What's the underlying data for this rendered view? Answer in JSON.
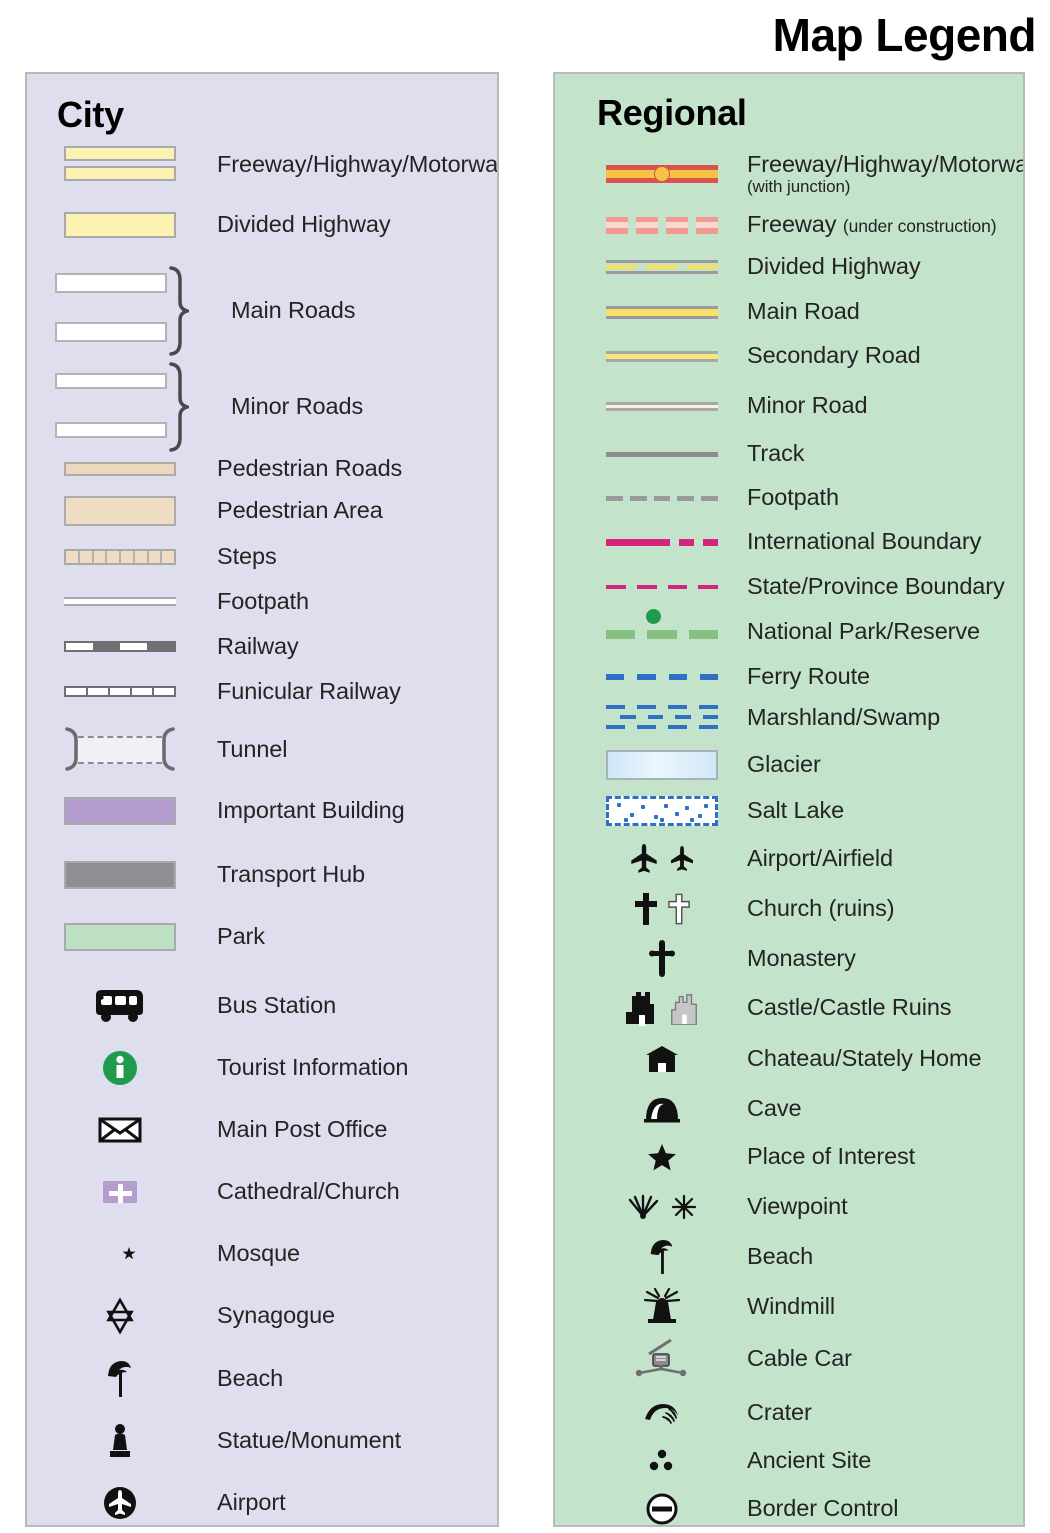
{
  "title": "Map Legend",
  "panels": {
    "city": {
      "heading": "City",
      "bg_color": "#dedeee",
      "items": [
        {
          "label": "Freeway/Highway/Motorway",
          "symbol": "city-freeway"
        },
        {
          "label": "Divided Highway",
          "symbol": "city-divided-highway"
        },
        {
          "label": "Main Roads",
          "symbol": "city-main-roads-braced"
        },
        {
          "label": "Minor Roads",
          "symbol": "city-minor-roads-braced"
        },
        {
          "label": "Pedestrian Roads",
          "symbol": "city-pedestrian-road"
        },
        {
          "label": "Pedestrian Area",
          "symbol": "city-pedestrian-area"
        },
        {
          "label": "Steps",
          "symbol": "city-steps"
        },
        {
          "label": "Footpath",
          "symbol": "city-footpath"
        },
        {
          "label": "Railway",
          "symbol": "city-railway"
        },
        {
          "label": "Funicular Railway",
          "symbol": "city-funicular-railway"
        },
        {
          "label": "Tunnel",
          "symbol": "city-tunnel"
        },
        {
          "label": "Important Building",
          "symbol": "city-important-building-swatch"
        },
        {
          "label": "Transport Hub",
          "symbol": "city-transport-hub-swatch"
        },
        {
          "label": "Park",
          "symbol": "city-park-swatch"
        },
        {
          "label": "Bus Station",
          "symbol": "bus-icon"
        },
        {
          "label": "Tourist Information",
          "symbol": "information-icon"
        },
        {
          "label": "Main Post Office",
          "symbol": "envelope-icon"
        },
        {
          "label": "Cathedral/Church",
          "symbol": "cross-on-square-icon"
        },
        {
          "label": "Mosque",
          "symbol": "star-and-crescent-icon"
        },
        {
          "label": "Synagogue",
          "symbol": "star-of-david-icon"
        },
        {
          "label": "Beach",
          "symbol": "beach-umbrella-icon"
        },
        {
          "label": "Statue/Monument",
          "symbol": "statue-icon"
        },
        {
          "label": "Airport",
          "symbol": "airplane-circle-icon"
        }
      ]
    },
    "regional": {
      "heading": "Regional",
      "bg_color": "#c4e3cb",
      "items": [
        {
          "label": "Freeway/Highway/Motorway",
          "sub": "(with junction)",
          "symbol": "regional-freeway-junction"
        },
        {
          "label": "Freeway",
          "inline_sub": "(under construction)",
          "symbol": "regional-freeway-under-construction"
        },
        {
          "label": "Divided Highway",
          "symbol": "regional-divided-highway"
        },
        {
          "label": "Main Road",
          "symbol": "regional-main-road"
        },
        {
          "label": "Secondary Road",
          "symbol": "regional-secondary-road"
        },
        {
          "label": "Minor Road",
          "symbol": "regional-minor-road"
        },
        {
          "label": "Track",
          "symbol": "regional-track"
        },
        {
          "label": "Footpath",
          "symbol": "regional-footpath"
        },
        {
          "label": "International Boundary",
          "symbol": "regional-international-boundary"
        },
        {
          "label": "State/Province Boundary",
          "symbol": "regional-state-boundary"
        },
        {
          "label": "National Park/Reserve",
          "symbol": "regional-national-park"
        },
        {
          "label": "Ferry Route",
          "symbol": "regional-ferry-route"
        },
        {
          "label": "Marshland/Swamp",
          "symbol": "regional-marshland"
        },
        {
          "label": "Glacier",
          "symbol": "regional-glacier"
        },
        {
          "label": "Salt Lake",
          "symbol": "regional-salt-lake"
        },
        {
          "label": "Airport/Airfield",
          "symbol": "airplane-pair-icon"
        },
        {
          "label": "Church (ruins)",
          "symbol": "cross-pair-icon"
        },
        {
          "label": "Monastery",
          "symbol": "budded-cross-icon"
        },
        {
          "label": "Castle/Castle Ruins",
          "symbol": "castle-pair-icon"
        },
        {
          "label": "Chateau/Stately Home",
          "symbol": "chateau-icon"
        },
        {
          "label": "Cave",
          "symbol": "cave-icon"
        },
        {
          "label": "Place of Interest",
          "symbol": "star-icon"
        },
        {
          "label": "Viewpoint",
          "symbol": "viewpoint-pair-icon"
        },
        {
          "label": "Beach",
          "symbol": "beach-umbrella-icon"
        },
        {
          "label": "Windmill",
          "symbol": "windmill-icon"
        },
        {
          "label": "Cable Car",
          "symbol": "cable-car-icon"
        },
        {
          "label": "Crater",
          "symbol": "crater-icon"
        },
        {
          "label": "Ancient Site",
          "symbol": "ancient-site-icon"
        },
        {
          "label": "Border Control",
          "symbol": "border-control-icon"
        }
      ]
    }
  },
  "colors": {
    "city_panel": "#dedeee",
    "regional_panel": "#c4e3cb",
    "panel_border": "#b9b9bd",
    "highway_yellow": "#fbf1b0",
    "pedestrian_tan": "#eeddc2",
    "important_building_purple": "#b49ccf",
    "transport_hub_gray": "#8f8f93",
    "park_green": "#bee0c2",
    "freeway_red": "#d9534f",
    "freeway_orange": "#f6c243",
    "boundary_magenta": "#d4247e",
    "park_dash_green": "#86c181",
    "park_dot_green": "#1e9b4c",
    "water_blue": "#2f6fc4",
    "tourist_info_green": "#1e9b4c",
    "text": "#242424"
  }
}
